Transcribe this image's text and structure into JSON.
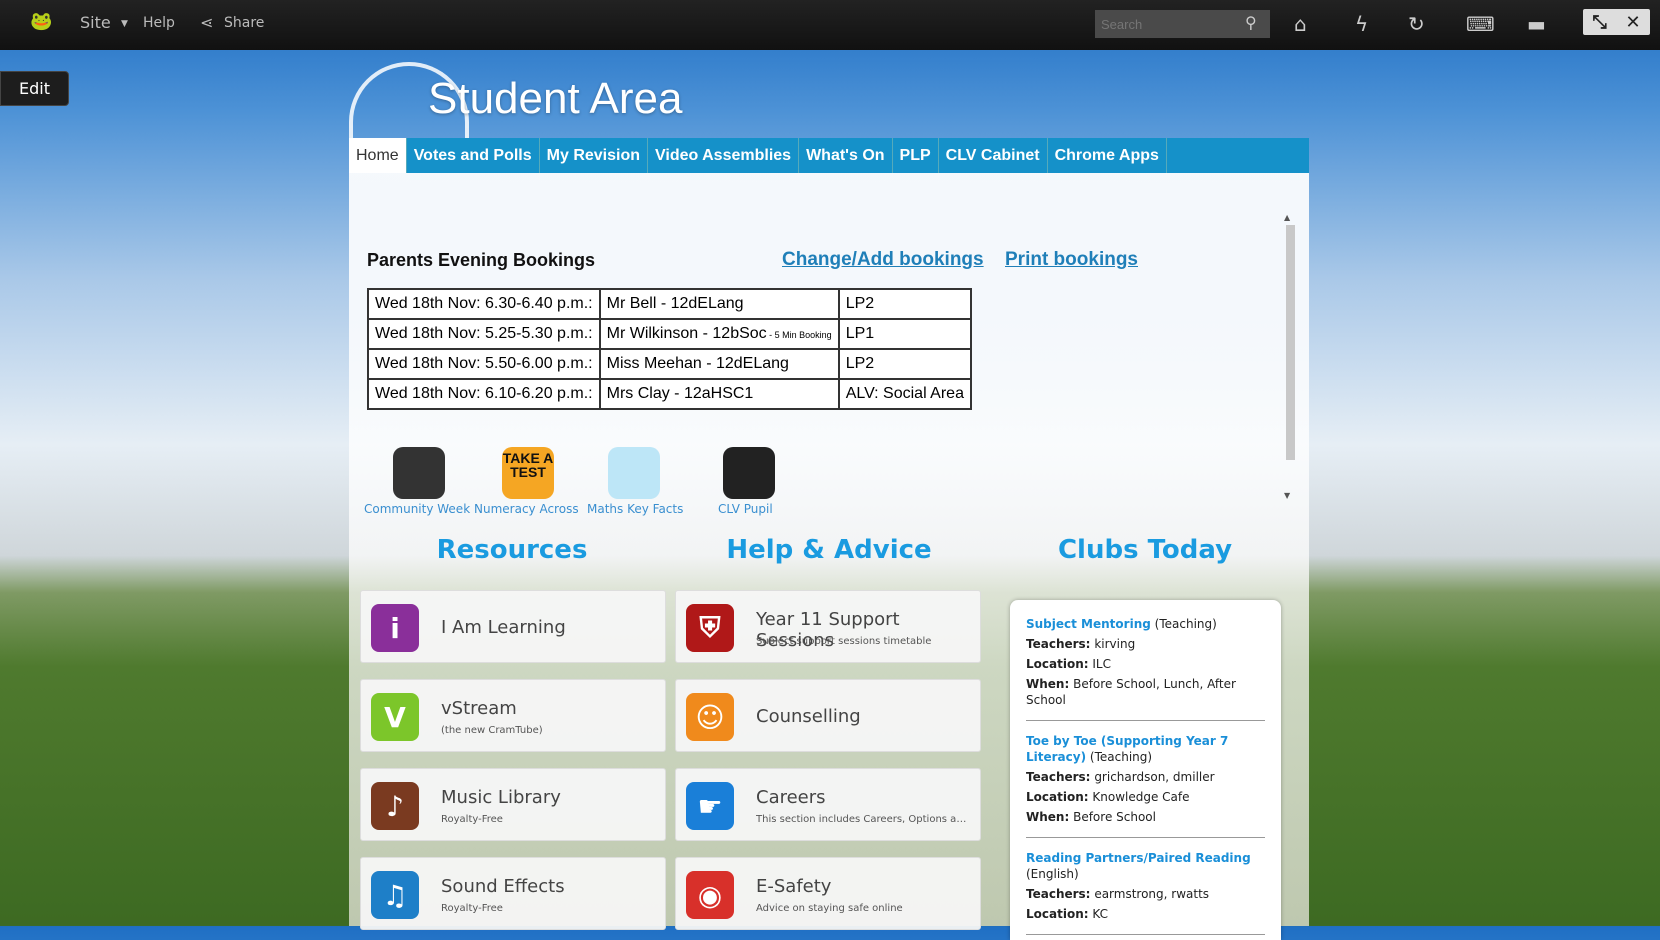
{
  "topbar": {
    "site": "Site",
    "help": "Help",
    "share": "Share",
    "search_placeholder": "Search",
    "icons": [
      "home-icon",
      "lightning-icon",
      "sync-icon",
      "keyboard-icon",
      "chat-icon"
    ]
  },
  "edit_label": "Edit",
  "title": "Student Area",
  "nav": [
    "Home",
    "Votes and Polls",
    "My Revision",
    "Video Assemblies",
    "What's On",
    "PLP",
    "CLV Cabinet",
    "Chrome Apps"
  ],
  "bookings": {
    "heading": "Parents Evening Bookings",
    "change_link": "Change/Add bookings",
    "print_link": "Print bookings",
    "rows": [
      {
        "time": "Wed 18th Nov: 6.30-6.40 p.m.:",
        "teacher": "Mr Bell - 12dELang",
        "note": "",
        "room": "LP2"
      },
      {
        "time": "Wed 18th Nov: 5.25-5.30 p.m.:",
        "teacher": "Mr Wilkinson - 12bSoc",
        "note": " - 5 Min Booking",
        "room": "LP1"
      },
      {
        "time": "Wed 18th Nov: 5.50-6.00 p.m.:",
        "teacher": "Miss Meehan - 12dELang",
        "note": "",
        "room": "LP2"
      },
      {
        "time": "Wed 18th Nov: 6.10-6.20 p.m.:",
        "teacher": "Mrs Clay - 12aHSC1",
        "note": "",
        "room": "ALV: Social Area"
      }
    ]
  },
  "quick_links": [
    {
      "label": "Community Week"
    },
    {
      "label": "Numeracy Across",
      "icon_text": "TAKE A TEST"
    },
    {
      "label": "Maths Key Facts"
    },
    {
      "label": "CLV Pupil"
    }
  ],
  "sections": {
    "resources": "Resources",
    "help": "Help & Advice",
    "clubs": "Clubs Today"
  },
  "resources": [
    {
      "title": "I Am Learning",
      "sub": "",
      "icon": "i",
      "color": "#8a2f9a"
    },
    {
      "title": "vStream",
      "sub": "(the new CramTube)",
      "icon": "V",
      "color": "#7cc62a"
    },
    {
      "title": "Music Library",
      "sub": "Royalty-Free",
      "icon": "♪",
      "color": "#7a3a20"
    },
    {
      "title": "Sound Effects",
      "sub": "Royalty-Free",
      "icon": "♫",
      "color": "#1e7fc8"
    }
  ],
  "help": [
    {
      "title": "Year 11 Support Sessions",
      "sub": "Subject support sessions timetable",
      "icon": "⛨",
      "color": "#b01818"
    },
    {
      "title": "Counselling",
      "sub": "",
      "icon": "☺",
      "color": "#f08a1c"
    },
    {
      "title": "Careers",
      "sub": "This section includes Careers, Options and o...",
      "icon": "☛",
      "color": "#1a7fd8"
    },
    {
      "title": "E-Safety",
      "sub": "Advice on staying safe online",
      "icon": "◉",
      "color": "#d8302a"
    }
  ],
  "clubs": [
    {
      "name": "Subject Mentoring",
      "dept": "(Teaching)",
      "teachers": "kirving",
      "location": "ILC",
      "when": "Before School, Lunch, After School"
    },
    {
      "name": "Toe by Toe (Supporting Year 7 Literacy)",
      "dept": "(Teaching)",
      "teachers": "grichardson, dmiller",
      "location": "Knowledge Cafe",
      "when": "Before School"
    },
    {
      "name": "Reading Partners/Paired Reading",
      "dept": "(English)",
      "teachers": "earmstrong, rwatts",
      "location": "KC",
      "when": ""
    }
  ],
  "labels": {
    "teachers": "Teachers:",
    "location": "Location:",
    "when": "When:"
  }
}
